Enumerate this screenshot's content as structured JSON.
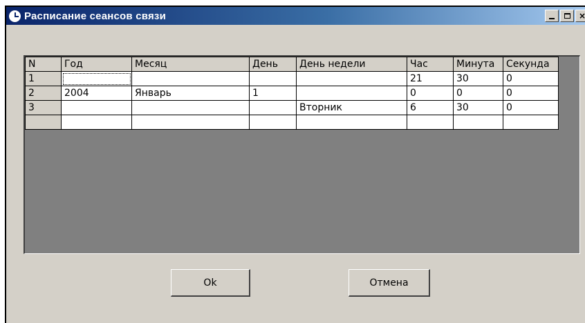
{
  "window": {
    "title": "Расписание сеансов связи",
    "controls": [
      "minimize",
      "maximize",
      "close"
    ],
    "close_glyph": "×"
  },
  "grid": {
    "columns": [
      "N",
      "Год",
      "Месяц",
      "День",
      "День недели",
      "Час",
      "Минута",
      "Секунда"
    ],
    "rows": [
      [
        "1",
        "",
        "",
        "",
        "",
        "21",
        "30",
        "0"
      ],
      [
        "2",
        "2004",
        "Январь",
        "1",
        "",
        "0",
        "0",
        "0"
      ],
      [
        "3",
        "",
        "",
        "",
        "Вторник",
        "6",
        "30",
        "0"
      ],
      [
        "",
        "",
        "",
        "",
        "",
        "",
        "",
        ""
      ]
    ]
  },
  "buttons": {
    "ok_label": "Ok",
    "cancel_label": "Отмена"
  },
  "colors": {
    "titlebar_start": "#0a246a",
    "titlebar_end": "#a6caf0",
    "face": "#d4d0c8",
    "grid_background": "#808080"
  }
}
